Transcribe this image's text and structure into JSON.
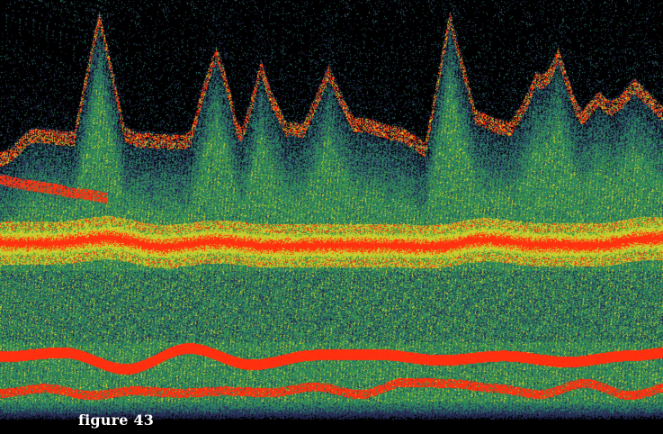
{
  "figure": {
    "caption": "figure 43"
  },
  "palette": {
    "background": "#000000",
    "low": "#1b2347",
    "mid_low": "#2f6f6a",
    "mid": "#3f9a4a",
    "mid_high": "#c8cc2a",
    "high": "#ff2a10"
  }
}
